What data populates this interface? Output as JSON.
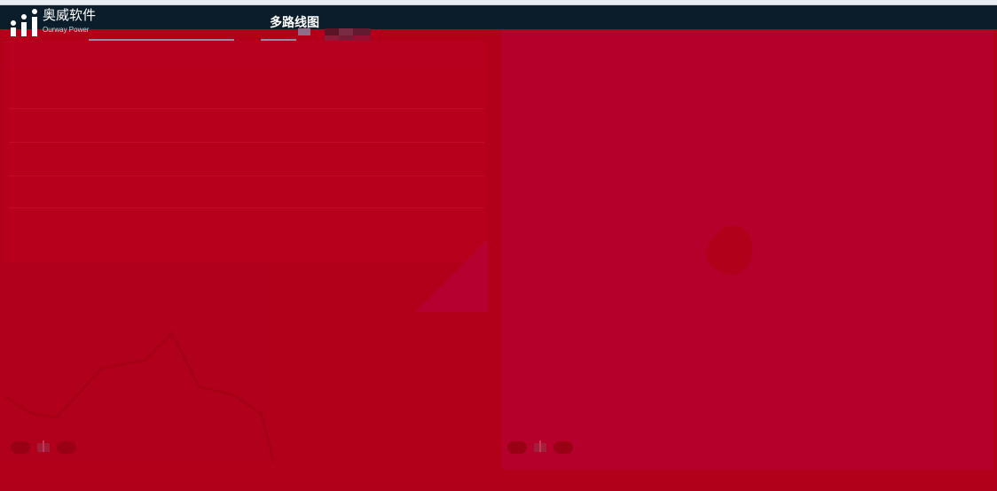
{
  "header": {
    "logo_name": "奥威软件",
    "logo_sub": "Ourway Power",
    "page_title": "多路线图"
  },
  "icons": {
    "logo": "bar-people-icon",
    "gift": "gift-icon"
  },
  "colors": {
    "header_bg": "#0b1c2b",
    "overlay_red": "#b3001a",
    "overlay_crimson": "#b4002a"
  }
}
